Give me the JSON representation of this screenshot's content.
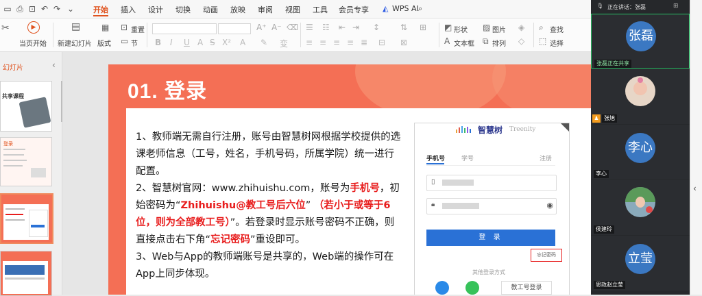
{
  "menu": {
    "items": [
      "开始",
      "插入",
      "设计",
      "切换",
      "动画",
      "放映",
      "审阅",
      "视图",
      "工具",
      "会员专享"
    ],
    "active": "开始",
    "wps_ai": "WPS AI"
  },
  "toolbar": {
    "start_from_current": "当页开始",
    "new_slide": "新建幻灯片",
    "layout": "版式",
    "section": "节",
    "reset": "重置",
    "shape": "形状",
    "picture": "图片",
    "textbox": "文本框",
    "arrange": "排列",
    "find": "查找",
    "select": "选择"
  },
  "thumbnails": {
    "title": "幻灯片",
    "t1_text": "共享课程",
    "t2_text": "登录"
  },
  "slide": {
    "title": "01. 登录",
    "p1": "1、教师端无需自行注册，账号由智慧树网根据学校提供的选课老师信息（工号，姓名，手机号码，所属学院）统一进行配置。",
    "p2a": "2、智慧树官网：www.zhihuishu.com，账号为",
    "p2b": "手机号",
    "p2c": "，初始密码为“",
    "p2d": "Zhihuishu@教工号后六位",
    "p2e": "” ",
    "p2f": "（若小于或等于6位，则为全部教工号）",
    "p2g": "”。若登录时显示账号密码不正确，则直接点击右下角“",
    "p2h": "忘记密码",
    "p2i": "”重设即可。",
    "p3": "3、Web与App的教师端账号是共享的，Web端的操作可在App上同步体现。"
  },
  "login_mock": {
    "brand": "智慧树",
    "brand_en": "Treenity",
    "tab_phone": "手机号",
    "tab_student": "学号",
    "tab_register": "注册",
    "login_btn": "登 录",
    "forgot": "忘记密码",
    "other": "其他登录方式",
    "staff_login": "教工号登录"
  },
  "meeting": {
    "speaking": "正在讲话：张磊",
    "participants": [
      {
        "avatar": "张磊",
        "tag": "张磊正在共享",
        "color": "#3b78c2"
      },
      {
        "avatar": "",
        "tag": "张旭",
        "color": "#cfa"
      },
      {
        "avatar": "李心",
        "tag": "李心",
        "color": "#3b78c2"
      },
      {
        "avatar": "",
        "tag": "侯建玲",
        "color": "#8ab"
      },
      {
        "avatar": "立莹",
        "tag": "思政赵立莹",
        "color": "#3b78c2"
      }
    ]
  },
  "colors": {
    "accent": "#e0531f",
    "slide_bg": "#f46f55",
    "highlight_red": "#e81d1d",
    "login_blue": "#2a71d6",
    "active_border": "#27c265"
  }
}
